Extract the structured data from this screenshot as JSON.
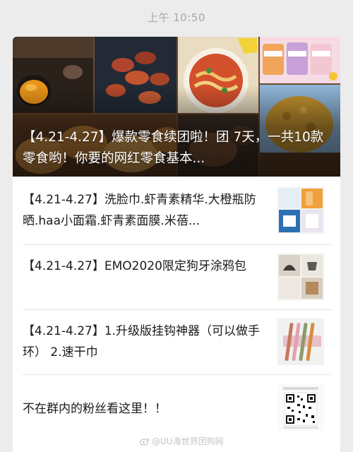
{
  "status_bar": {
    "time": "上午 10:50"
  },
  "hero": {
    "title": "【4.21-4.27】爆款零食续团啦！团 7天，一共10款零食哟！你要的网红零食基本...",
    "background_color": "#6b4a2e"
  },
  "articles": [
    {
      "title": "【4.21-4.27】洗脸巾.虾青素精华.大橙瓶防晒.haa小面霜.虾青素面膜.米蓓..."
    },
    {
      "title": "【4.21-4.27】EMO2020限定狗牙涂鸦包"
    },
    {
      "title": "【4.21-4.27】1.升级版挂钩神器（可以做手环） 2.速干巾"
    },
    {
      "title": "不在群内的粉丝看这里！！"
    }
  ],
  "watermark": {
    "text": "@UU海世界团购网",
    "icon": "weibo-icon"
  },
  "colors": {
    "background": "#ececec",
    "card": "#ffffff",
    "text": "#1a1a1a",
    "divider": "#e5e5e5",
    "status_text": "#a8a8a8"
  }
}
